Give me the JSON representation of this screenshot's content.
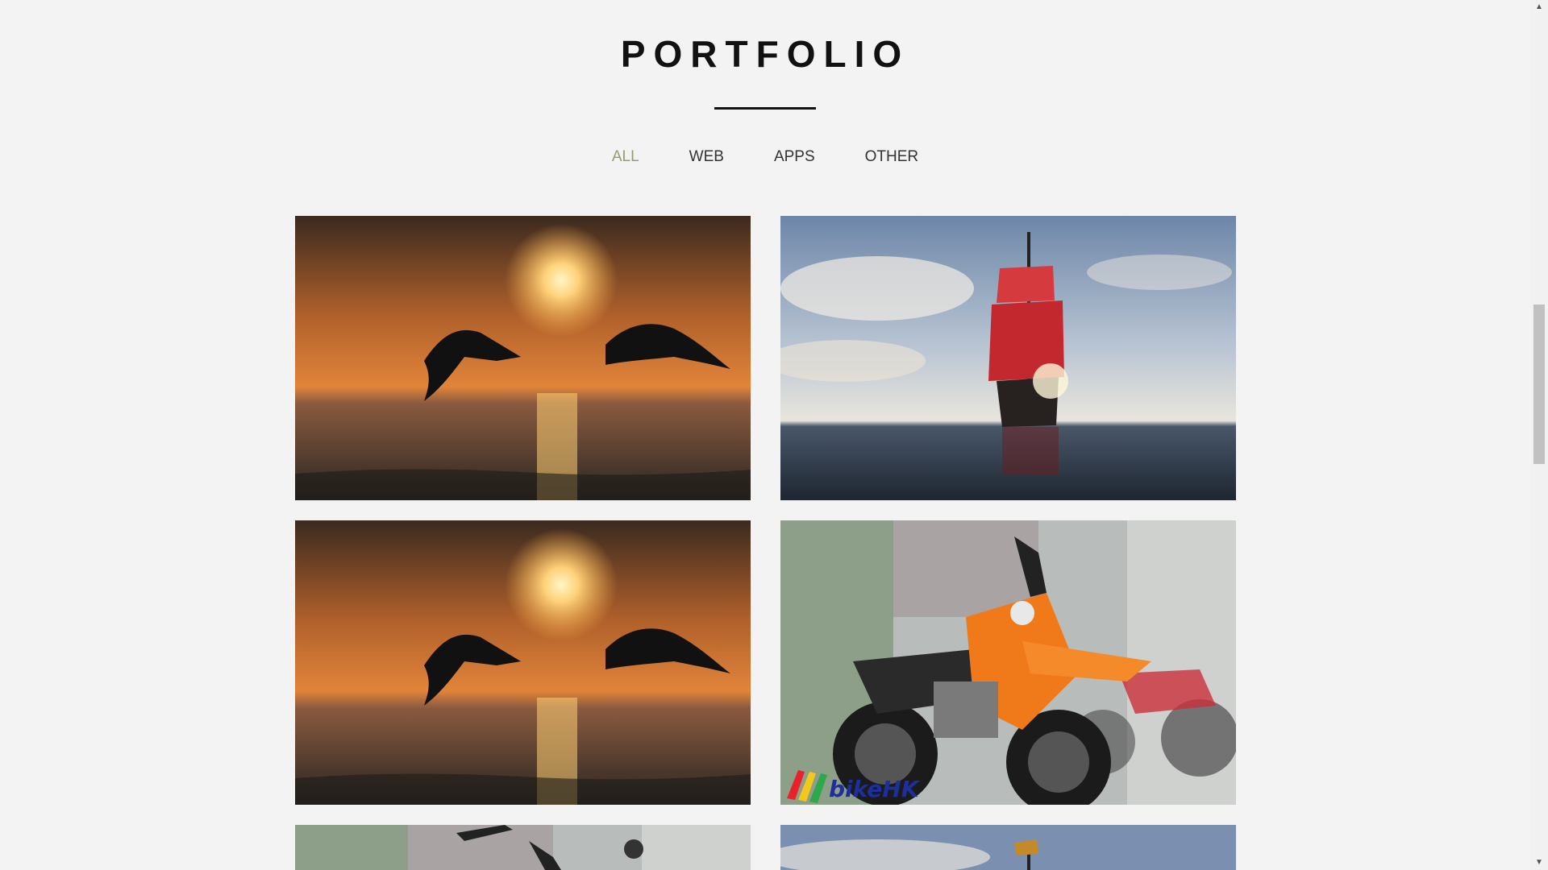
{
  "section": {
    "title": "PORTFOLIO"
  },
  "filters": [
    {
      "label": "ALL",
      "active": true
    },
    {
      "label": "WEB",
      "active": false
    },
    {
      "label": "APPS",
      "active": false
    },
    {
      "label": "OTHER",
      "active": false
    }
  ],
  "portfolio_items": [
    {
      "image": "dolphins-sunset-photo"
    },
    {
      "image": "red-sail-ship-photo"
    },
    {
      "image": "dolphins-sunset-photo"
    },
    {
      "image": "orange-motorbike-photo",
      "watermark_text": "bikeHK"
    },
    {
      "image": "orange-motorbike-photo"
    },
    {
      "image": "red-sail-ship-photo"
    }
  ],
  "colors": {
    "background": "#f3f3f3",
    "active_filter": "#9a9a70",
    "title": "#111111"
  }
}
